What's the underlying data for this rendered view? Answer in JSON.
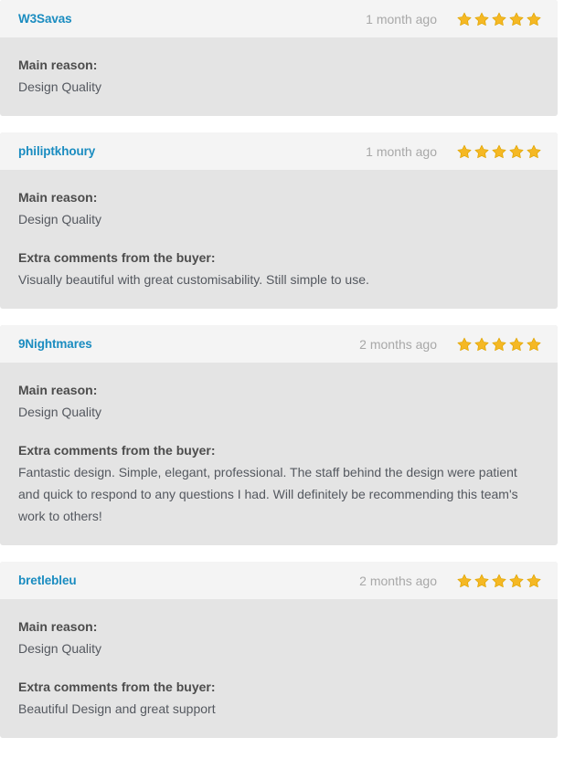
{
  "labels": {
    "main_reason": "Main reason:",
    "extra_comments": "Extra comments from the buyer:"
  },
  "colors": {
    "username_link": "#1a8cc0",
    "star_fill": "#f5b824",
    "star_stroke": "#e0a500",
    "card_body_bg": "#e4e4e4",
    "card_header_bg": "#f4f4f4",
    "timestamp_text": "#a8a8a8",
    "label_text": "#4c4c4c",
    "value_text": "#54585f",
    "page_bg": "#ffffff"
  },
  "icons": {
    "star": "star-icon"
  },
  "reviews": [
    {
      "username": "W3Savas",
      "time_ago": "1 month ago",
      "rating": 5,
      "main_reason": "Design Quality",
      "extra_comments": ""
    },
    {
      "username": "philiptkhoury",
      "time_ago": "1 month ago",
      "rating": 5,
      "main_reason": "Design Quality",
      "extra_comments": "Visually beautiful with great customisability. Still simple to use."
    },
    {
      "username": "9Nightmares",
      "time_ago": "2 months ago",
      "rating": 5,
      "main_reason": "Design Quality",
      "extra_comments": "Fantastic design. Simple, elegant, professional. The staff behind the design were patient and quick to respond to any questions I had. Will definitely be recommending this team's work to others!"
    },
    {
      "username": "bretlebleu",
      "time_ago": "2 months ago",
      "rating": 5,
      "main_reason": "Design Quality",
      "extra_comments": "Beautiful Design and great support"
    }
  ]
}
